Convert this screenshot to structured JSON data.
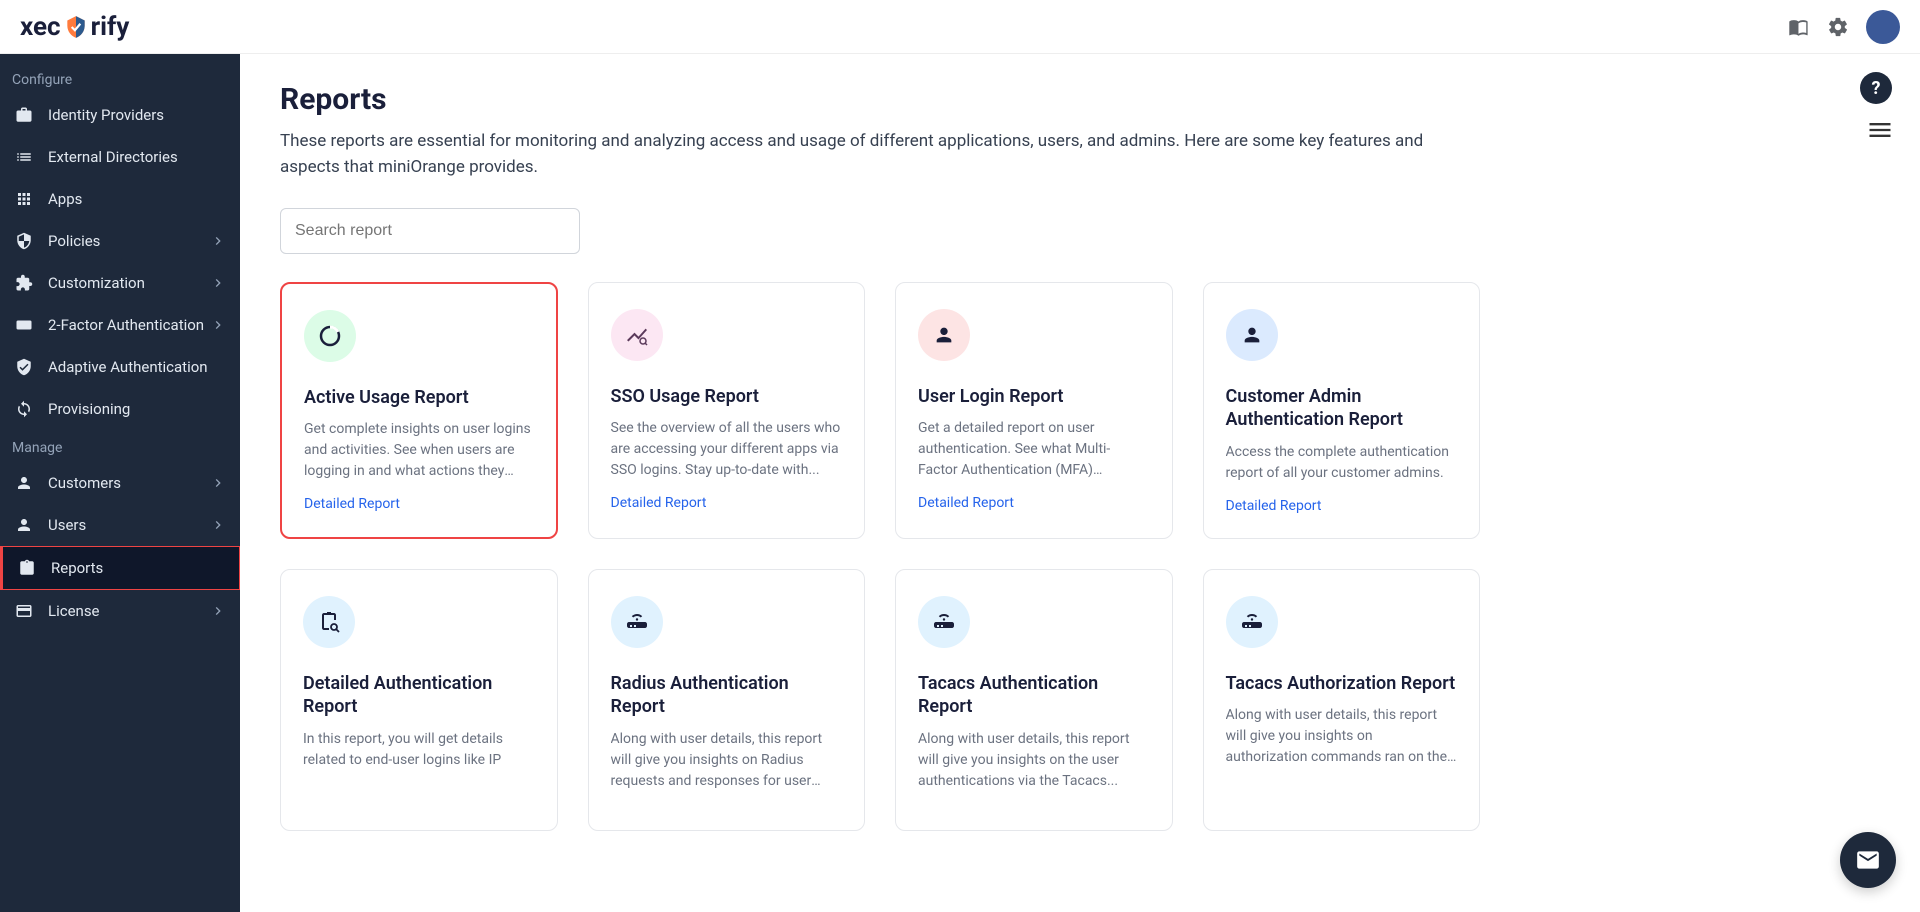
{
  "brand": {
    "text_left": "xec",
    "text_right": "rify"
  },
  "sidebar": {
    "section1": "Configure",
    "section2": "Manage",
    "items1": [
      {
        "label": "Identity Providers"
      },
      {
        "label": "External Directories"
      },
      {
        "label": "Apps"
      },
      {
        "label": "Policies"
      },
      {
        "label": "Customization"
      },
      {
        "label": "2-Factor Authentication"
      },
      {
        "label": "Adaptive Authentication"
      },
      {
        "label": "Provisioning"
      }
    ],
    "items2": [
      {
        "label": "Customers"
      },
      {
        "label": "Users"
      },
      {
        "label": "Reports"
      },
      {
        "label": "License"
      }
    ]
  },
  "page": {
    "title": "Reports",
    "description": "These reports are essential for monitoring and analyzing access and usage of different applications, users, and admins. Here are some key features and aspects that miniOrange provides.",
    "search_placeholder": "Search report",
    "detailed_link": "Detailed Report"
  },
  "cards": [
    {
      "title": "Active Usage Report",
      "desc": "Get complete insights on user logins and activities. See when users are logging in and what actions they are..."
    },
    {
      "title": "SSO Usage Report",
      "desc": "See the overview of all the users who are accessing your different apps via SSO logins. Stay up-to-date with..."
    },
    {
      "title": "User Login Report",
      "desc": "Get a detailed report on user authentication. See what Multi-Factor Authentication (MFA) methods..."
    },
    {
      "title": "Customer Admin Authentication Report",
      "desc": "Access the complete authentication report of all your customer admins."
    },
    {
      "title": "Detailed Authentication Report",
      "desc": "In this report, you will get details related to end-user logins like IP"
    },
    {
      "title": "Radius Authentication Report",
      "desc": "Along with user details, this report will give you insights on Radius requests and responses for user logins via the..."
    },
    {
      "title": "Tacacs Authentication Report",
      "desc": "Along with user details, this report will give you insights on the user authentications via the Tacacs..."
    },
    {
      "title": "Tacacs Authorization Report",
      "desc": "Along with user details, this report will give you insights on authorization commands ran on the Tacacs..."
    }
  ]
}
